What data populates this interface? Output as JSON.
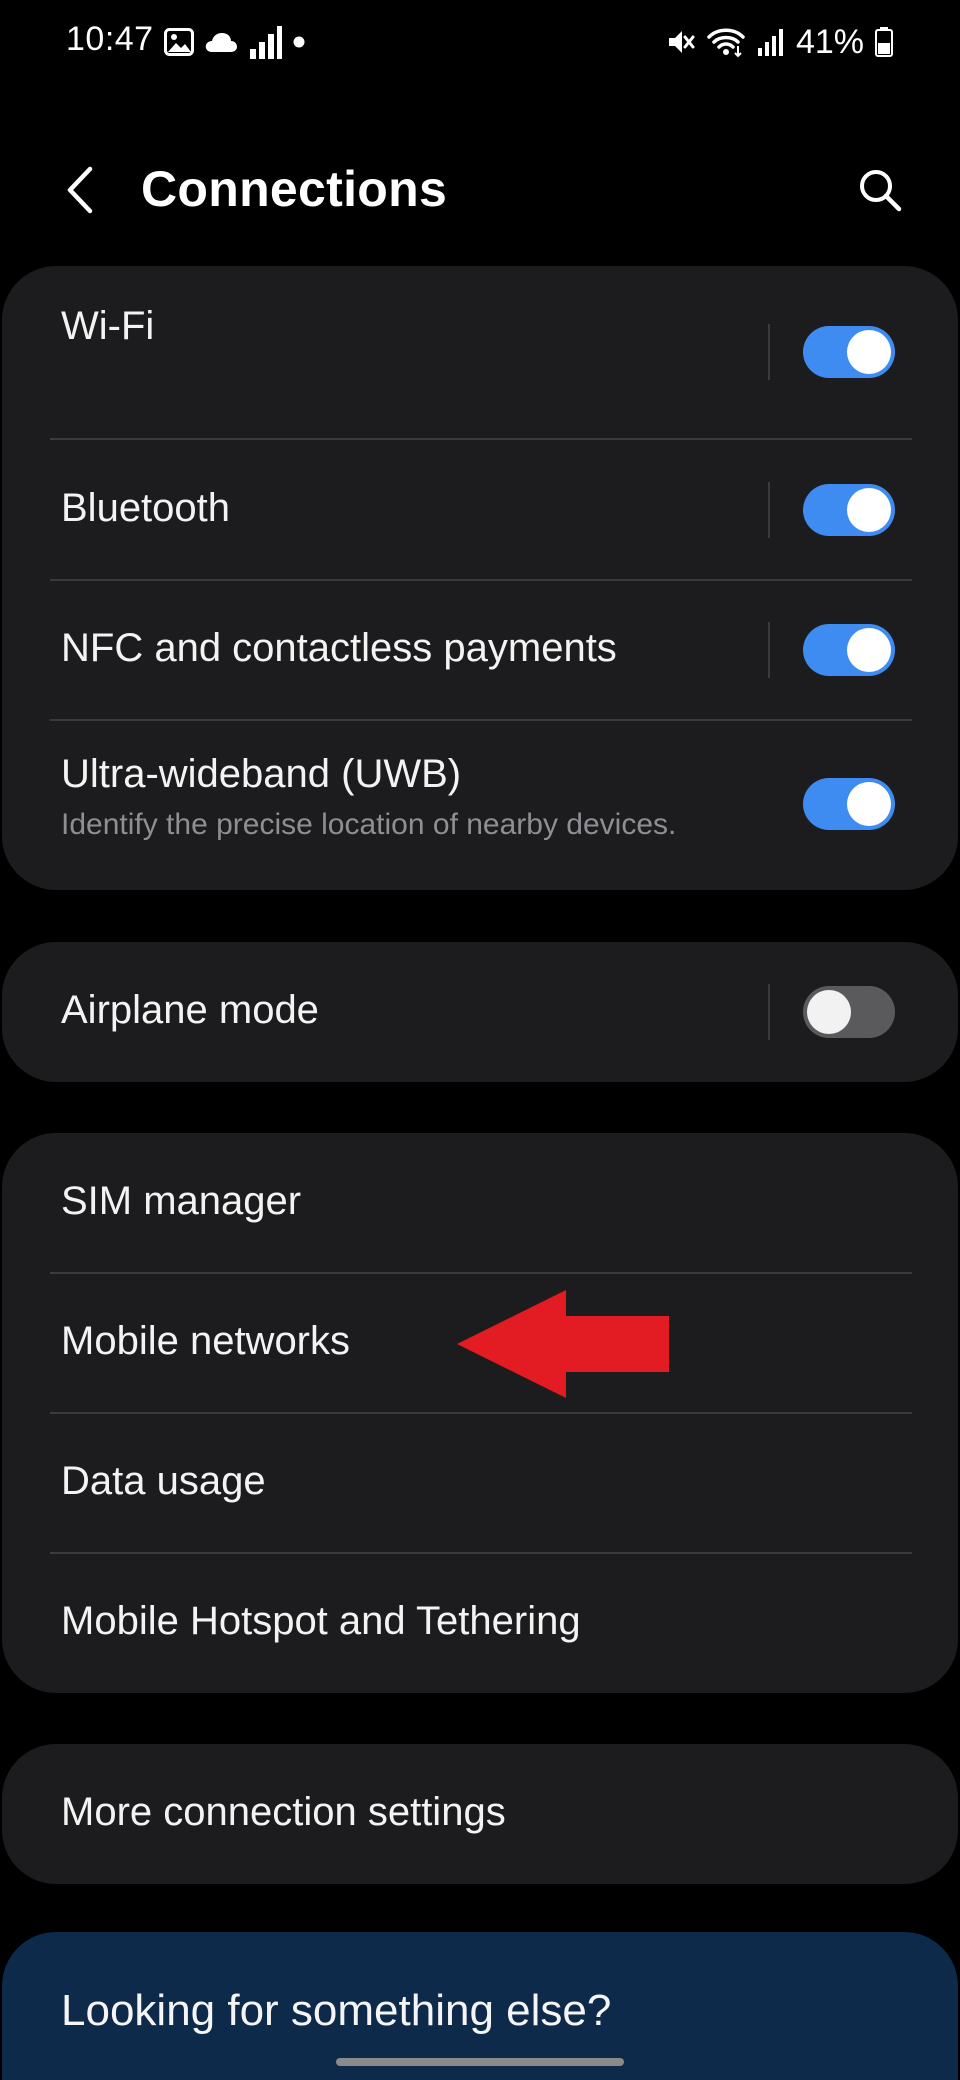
{
  "status_bar": {
    "time": "10:47",
    "left_icons": [
      "image-icon",
      "cloud-icon",
      "signal-bars-icon",
      "dot-icon"
    ],
    "right_icons": [
      "mute-icon",
      "wifi-icon",
      "cell-signal-icon",
      "battery-icon"
    ],
    "battery": "41%"
  },
  "header": {
    "back_icon": "back-arrow-icon",
    "title": "Connections",
    "search_icon": "search-icon"
  },
  "groups": {
    "radios": [
      {
        "label": "Wi-Fi",
        "toggle": true
      },
      {
        "label": "Bluetooth",
        "toggle": true
      },
      {
        "label": "NFC and contactless payments",
        "toggle": true
      },
      {
        "label": "Ultra-wideband (UWB)",
        "subtitle": "Identify the precise location of nearby devices.",
        "toggle": true
      }
    ],
    "airplane": {
      "label": "Airplane mode",
      "toggle": false
    },
    "network": [
      {
        "label": "SIM manager"
      },
      {
        "label": "Mobile networks"
      },
      {
        "label": "Data usage"
      },
      {
        "label": "Mobile Hotspot and Tethering"
      }
    ],
    "more": {
      "label": "More connection settings"
    }
  },
  "suggestion": {
    "label": "Looking for something else?"
  },
  "annotation": {
    "arrow_color": "#e31b23",
    "points_to": "Mobile networks"
  },
  "colors": {
    "background": "#000000",
    "card": "#1c1c1e",
    "toggle_on": "#3e8cf1",
    "toggle_off": "#5a5a5c",
    "suggestion_card": "#0d2a4a"
  }
}
